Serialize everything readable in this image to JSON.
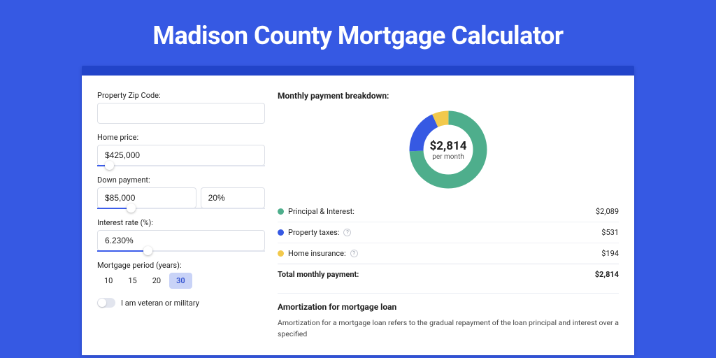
{
  "hero": {
    "title": "Madison County Mortgage Calculator"
  },
  "form": {
    "zip_label": "Property Zip Code:",
    "zip_value": "",
    "home_price_label": "Home price:",
    "home_price_value": "$425,000",
    "home_price_slider_pct": 7,
    "down_payment_label": "Down payment:",
    "down_payment_value": "$85,000",
    "down_payment_pct": "20%",
    "down_payment_slider_pct": 20,
    "rate_label": "Interest rate (%):",
    "rate_value": "6.230%",
    "rate_slider_pct": 30,
    "period_label": "Mortgage period (years):",
    "period_options": [
      "10",
      "15",
      "20",
      "30"
    ],
    "period_selected": "30",
    "veteran_label": "I am veteran or military",
    "veteran_on": false
  },
  "breakdown": {
    "heading": "Monthly payment breakdown:",
    "total": "$2,814",
    "per": "per month",
    "items": [
      {
        "label": "Principal & Interest:",
        "amount": "$2,089",
        "color": "#4eae8c",
        "info": false
      },
      {
        "label": "Property taxes:",
        "amount": "$531",
        "color": "#3659e3",
        "info": true
      },
      {
        "label": "Home insurance:",
        "amount": "$194",
        "color": "#f2c94c",
        "info": true
      }
    ],
    "total_label": "Total monthly payment:",
    "total_amount": "$2,814"
  },
  "amortization": {
    "heading": "Amortization for mortgage loan",
    "text": "Amortization for a mortgage loan refers to the gradual repayment of the loan principal and interest over a specified"
  },
  "chart_data": {
    "type": "pie",
    "title": "Monthly payment breakdown",
    "categories": [
      "Principal & Interest",
      "Property taxes",
      "Home insurance"
    ],
    "values": [
      2089,
      531,
      194
    ],
    "colors": [
      "#4eae8c",
      "#3659e3",
      "#f2c94c"
    ],
    "total": 2814,
    "donut": true
  }
}
